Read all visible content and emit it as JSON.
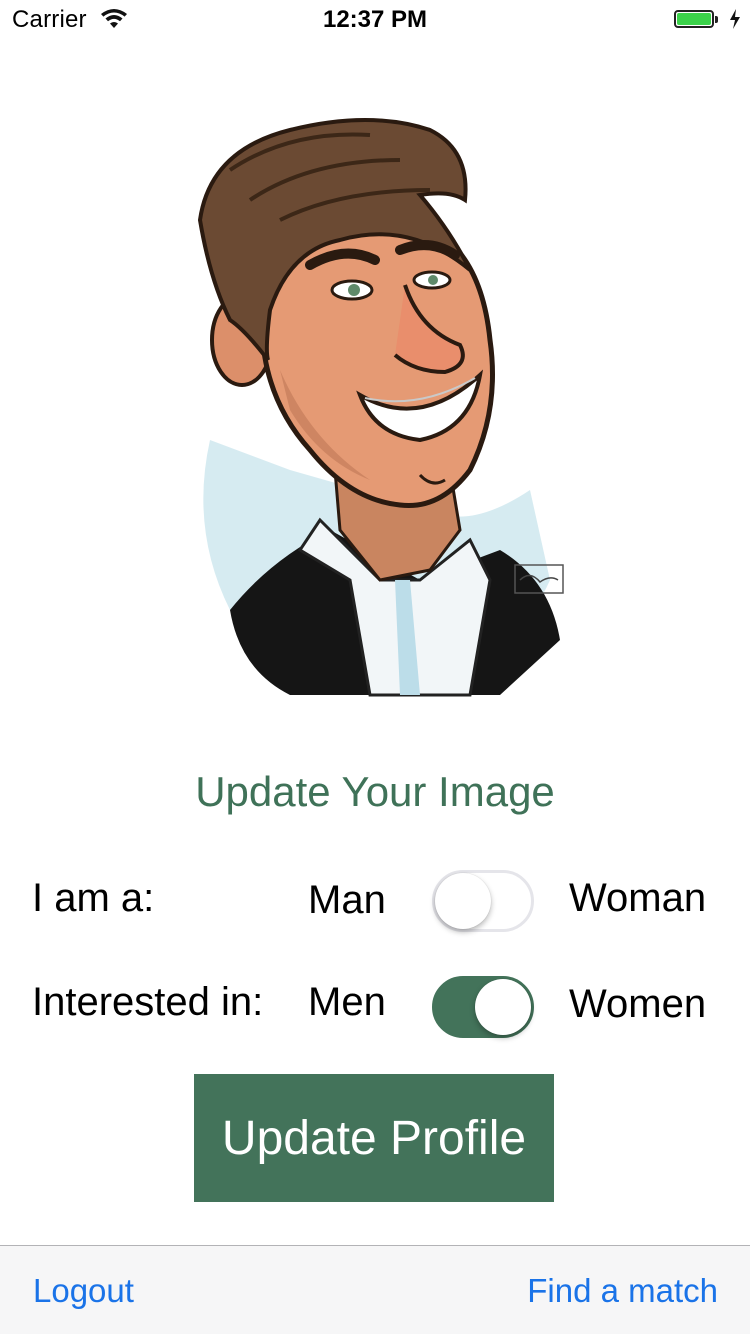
{
  "status_bar": {
    "carrier": "Carrier",
    "time": "12:37 PM",
    "battery_level": 1.0
  },
  "profile": {
    "avatar_description": "caricature-avatar",
    "update_image_label": "Update Your Image"
  },
  "gender": {
    "label": "I am a:",
    "left_option": "Man",
    "right_option": "Woman",
    "toggle_on": false
  },
  "interest": {
    "label": "Interested in:",
    "left_option": "Men",
    "right_option": "Women",
    "toggle_on": true
  },
  "update_profile_button": "Update Profile",
  "toolbar": {
    "left_label": "Logout",
    "right_label": "Find a match"
  },
  "colors": {
    "accent_green": "#43735a",
    "link_blue": "#1a73e8",
    "battery_green": "#3bd24a"
  }
}
